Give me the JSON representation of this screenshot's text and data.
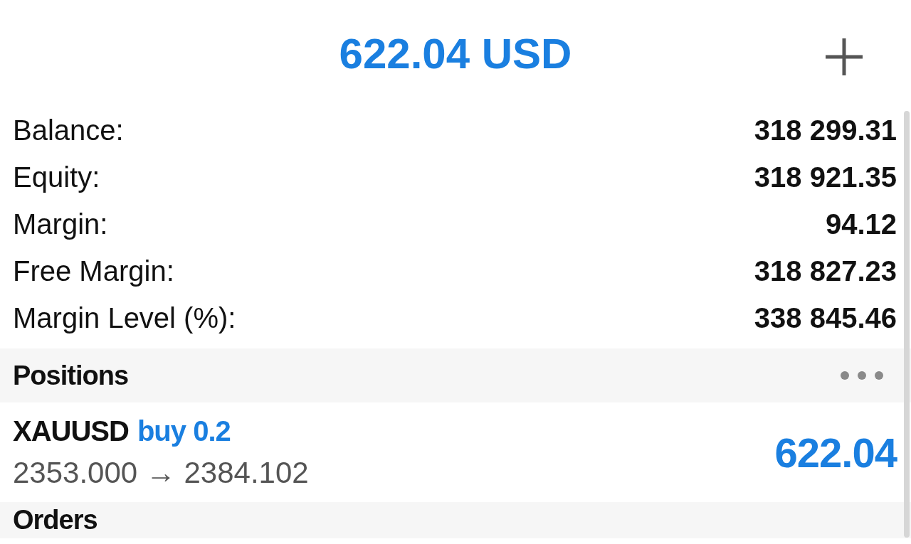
{
  "header": {
    "title": "622.04 USD"
  },
  "summary": [
    {
      "label": "Balance:",
      "value": "318 299.31"
    },
    {
      "label": "Equity:",
      "value": "318 921.35"
    },
    {
      "label": "Margin:",
      "value": "94.12"
    },
    {
      "label": "Free Margin:",
      "value": "318 827.23"
    },
    {
      "label": "Margin Level (%):",
      "value": "338 845.46"
    }
  ],
  "positions_section": {
    "title": "Positions"
  },
  "positions": [
    {
      "symbol": "XAUUSD",
      "side": "buy 0.2",
      "prices": "2353.000 → 2384.102",
      "profit": "622.04"
    }
  ],
  "orders_section": {
    "title": "Orders"
  }
}
